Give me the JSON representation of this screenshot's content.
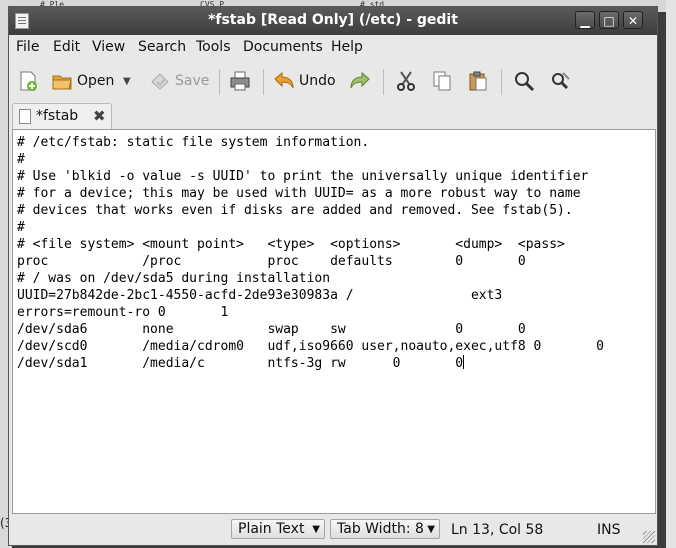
{
  "background": {
    "tab_a": "# Ple",
    "tab_b": "CVS_P",
    "tab_c": "# std",
    "bottom_left_text": "(3"
  },
  "window": {
    "title": "*fstab [Read Only] (/etc) - gedit",
    "controls": {
      "minimize": "▁",
      "maximize": "□",
      "close": "✕"
    }
  },
  "menubar": [
    "File",
    "Edit",
    "View",
    "Search",
    "Tools",
    "Documents",
    "Help"
  ],
  "toolbar": {
    "new_icon": "new-document-icon",
    "open_label": "Open",
    "save_label": "Save",
    "undo_label": "Undo",
    "print_icon": "printer-icon",
    "redo_icon": "redo-arrow-icon",
    "cut_icon": "scissors-icon",
    "copy_icon": "copy-icon",
    "paste_icon": "clipboard-icon",
    "find_icon": "magnifier-icon",
    "replace_icon": "find-replace-icon"
  },
  "tab": {
    "label": "*fstab",
    "close": "✖"
  },
  "editor": {
    "lines": [
      "# /etc/fstab: static file system information.",
      "#",
      "# Use 'blkid -o value -s UUID' to print the universally unique identifier",
      "# for a device; this may be used with UUID= as a more robust way to name",
      "# devices that works even if disks are added and removed. See fstab(5).",
      "#",
      "# <file system> <mount point>   <type>  <options>       <dump>  <pass>",
      "proc            /proc           proc    defaults        0       0",
      "# / was on /dev/sda5 during installation",
      "UUID=27b842de-2bc1-4550-acfd-2de93e30983a /               ext3",
      "errors=remount-ro 0       1",
      "/dev/sda6       none            swap    sw              0       0",
      "/dev/scd0       /media/cdrom0   udf,iso9660 user,noauto,exec,utf8 0       0",
      "/dev/sda1       /media/c        ntfs-3g rw      0       0"
    ]
  },
  "statusbar": {
    "language": "Plain Text",
    "tab_width": "Tab Width:  8",
    "position": "Ln 13, Col 58",
    "mode": "INS"
  }
}
